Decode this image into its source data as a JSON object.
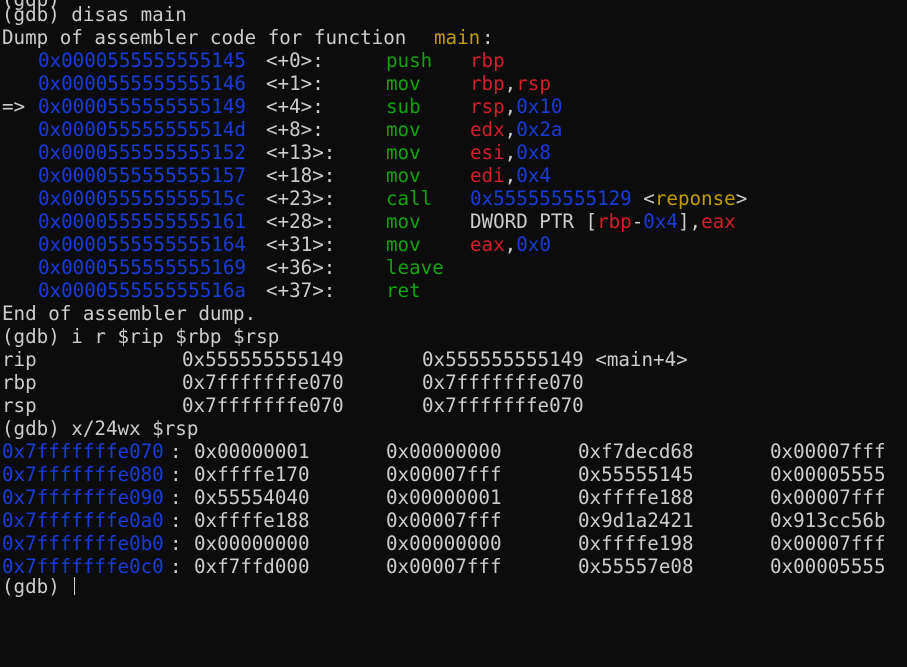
{
  "colors": {
    "bg": "#0c0c0c",
    "fg": "#cccccc",
    "addr": "#1a3ad8",
    "mnemonic": "#13a10e",
    "reg": "#d11f2c",
    "num": "#1a3ad8",
    "sym": "#c19c00"
  },
  "lines": {
    "top_partial": "(gdb)",
    "cmd_disas": "(gdb) disas main",
    "dump_header_prefix": "Dump of assembler code for function ",
    "dump_header_func": "main",
    "dump_header_suffix": ":",
    "end_dump": "End of assembler dump.",
    "cmd_info": "(gdb) i r $rip $rbp $rsp",
    "cmd_x": "(gdb) x/24wx $rsp",
    "bottom_prompt": "(gdb)"
  },
  "disassembly": [
    {
      "marker": "",
      "addr": "0x0000555555555145",
      "off": "<+0>:",
      "mnem": "push",
      "ops": [
        {
          "t": "rbp",
          "c": "reg"
        }
      ]
    },
    {
      "marker": "",
      "addr": "0x0000555555555146",
      "off": "<+1>:",
      "mnem": "mov",
      "ops": [
        {
          "t": "rbp",
          "c": "reg"
        },
        {
          "t": ",",
          "c": "fg"
        },
        {
          "t": "rsp",
          "c": "reg"
        }
      ]
    },
    {
      "marker": "=>",
      "addr": "0x0000555555555149",
      "off": "<+4>:",
      "mnem": "sub",
      "ops": [
        {
          "t": "rsp",
          "c": "reg"
        },
        {
          "t": ",",
          "c": "fg"
        },
        {
          "t": "0x10",
          "c": "num"
        }
      ]
    },
    {
      "marker": "",
      "addr": "0x000055555555514d",
      "off": "<+8>:",
      "mnem": "mov",
      "ops": [
        {
          "t": "edx",
          "c": "reg"
        },
        {
          "t": ",",
          "c": "fg"
        },
        {
          "t": "0x2a",
          "c": "num"
        }
      ]
    },
    {
      "marker": "",
      "addr": "0x0000555555555152",
      "off": "<+13>:",
      "mnem": "mov",
      "ops": [
        {
          "t": "esi",
          "c": "reg"
        },
        {
          "t": ",",
          "c": "fg"
        },
        {
          "t": "0x8",
          "c": "num"
        }
      ]
    },
    {
      "marker": "",
      "addr": "0x0000555555555157",
      "off": "<+18>:",
      "mnem": "mov",
      "ops": [
        {
          "t": "edi",
          "c": "reg"
        },
        {
          "t": ",",
          "c": "fg"
        },
        {
          "t": "0x4",
          "c": "num"
        }
      ]
    },
    {
      "marker": "",
      "addr": "0x000055555555515c",
      "off": "<+23>:",
      "mnem": "call",
      "ops": [
        {
          "t": "0x555555555129",
          "c": "num"
        },
        {
          "t": " <",
          "c": "fg"
        },
        {
          "t": "reponse",
          "c": "sym"
        },
        {
          "t": ">",
          "c": "fg"
        }
      ]
    },
    {
      "marker": "",
      "addr": "0x0000555555555161",
      "off": "<+28>:",
      "mnem": "mov",
      "ops": [
        {
          "t": "DWORD PTR [",
          "c": "fg"
        },
        {
          "t": "rbp",
          "c": "reg"
        },
        {
          "t": "-",
          "c": "fg"
        },
        {
          "t": "0x4",
          "c": "num"
        },
        {
          "t": "],",
          "c": "fg"
        },
        {
          "t": "eax",
          "c": "reg"
        }
      ]
    },
    {
      "marker": "",
      "addr": "0x0000555555555164",
      "off": "<+31>:",
      "mnem": "mov",
      "ops": [
        {
          "t": "eax",
          "c": "reg"
        },
        {
          "t": ",",
          "c": "fg"
        },
        {
          "t": "0x0",
          "c": "num"
        }
      ]
    },
    {
      "marker": "",
      "addr": "0x0000555555555169",
      "off": "<+36>:",
      "mnem": "leave",
      "ops": []
    },
    {
      "marker": "",
      "addr": "0x000055555555516a",
      "off": "<+37>:",
      "mnem": "ret",
      "ops": []
    }
  ],
  "registers": [
    {
      "name": "rip",
      "hex": "0x555555555149",
      "val": "0x555555555149 <main+4>"
    },
    {
      "name": "rbp",
      "hex": "0x7fffffffe070",
      "val": "0x7fffffffe070"
    },
    {
      "name": "rsp",
      "hex": "0x7fffffffe070",
      "val": "0x7fffffffe070"
    }
  ],
  "memory": [
    {
      "addr": "0x7fffffffe070",
      "words": [
        "0x00000001",
        "0x00000000",
        "0xf7decd68",
        "0x00007fff"
      ]
    },
    {
      "addr": "0x7fffffffe080",
      "words": [
        "0xffffe170",
        "0x00007fff",
        "0x55555145",
        "0x00005555"
      ]
    },
    {
      "addr": "0x7fffffffe090",
      "words": [
        "0x55554040",
        "0x00000001",
        "0xffffe188",
        "0x00007fff"
      ]
    },
    {
      "addr": "0x7fffffffe0a0",
      "words": [
        "0xffffe188",
        "0x00007fff",
        "0x9d1a2421",
        "0x913cc56b"
      ]
    },
    {
      "addr": "0x7fffffffe0b0",
      "words": [
        "0x00000000",
        "0x00000000",
        "0xffffe198",
        "0x00007fff"
      ]
    },
    {
      "addr": "0x7fffffffe0c0",
      "words": [
        "0xf7ffd000",
        "0x00007fff",
        "0x55557e08",
        "0x00005555"
      ]
    }
  ]
}
